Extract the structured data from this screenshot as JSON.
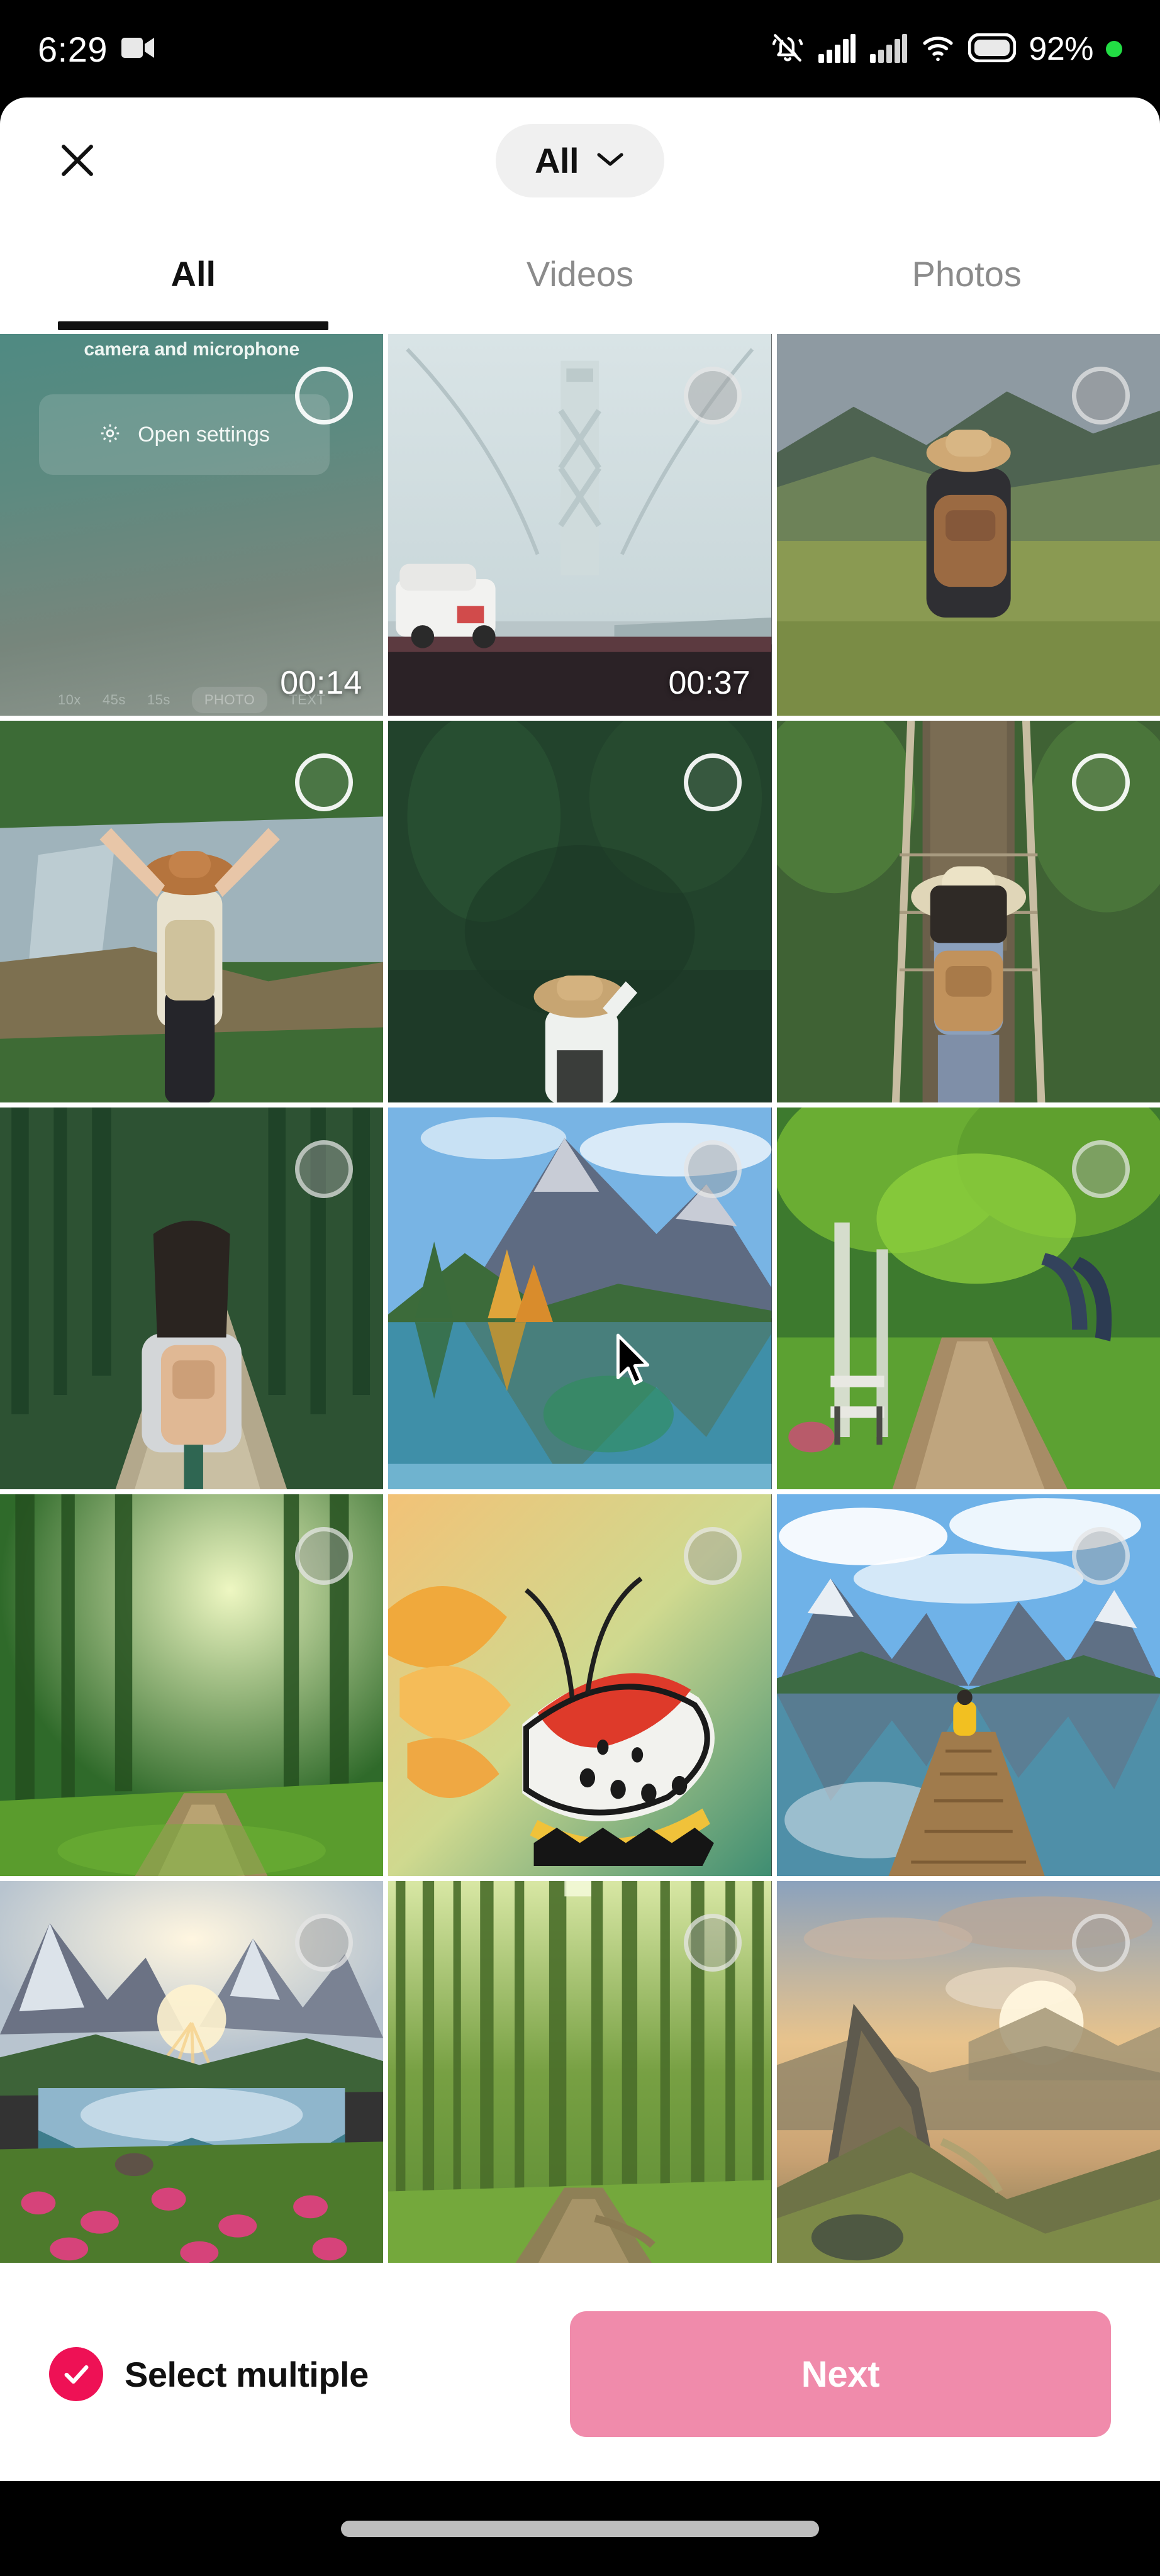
{
  "status_bar": {
    "time": "6:29",
    "battery_percent": "92%",
    "icons": [
      "video-camera-icon",
      "notifications-silenced-icon",
      "cellular-signal-1-icon",
      "cellular-signal-2-icon",
      "wifi-icon",
      "battery-icon",
      "privacy-indicator-dot"
    ],
    "privacy_dot_color": "#22dd44"
  },
  "header": {
    "close_label": "Close",
    "filter_label": "All",
    "filter_chevron": "chevron-down-icon",
    "pill_bg": "#f0f0f0"
  },
  "tabs": [
    {
      "label": "All",
      "active": true
    },
    {
      "label": "Videos",
      "active": false
    },
    {
      "label": "Photos",
      "active": false
    }
  ],
  "gallery": {
    "items": [
      {
        "id": "tile-1",
        "kind": "video",
        "duration": "00:14",
        "description": "screen recording showing camera and microphone permission prompt",
        "overlay": {
          "title": "camera and microphone",
          "button": "Open settings",
          "button_icon": "gear-icon",
          "modes": [
            "10x",
            "45s",
            "15s",
            "PHOTO",
            "TEXT"
          ],
          "active_mode": "PHOTO"
        },
        "selected": false,
        "checkbox_dim": false
      },
      {
        "id": "tile-2",
        "kind": "video",
        "duration": "00:37",
        "description": "dashcam view of suspension bridge with white SUV",
        "selected": false,
        "checkbox_dim": true
      },
      {
        "id": "tile-3",
        "kind": "photo",
        "duration": "",
        "description": "hiker with backpack and beanie in green mountain meadow",
        "selected": false,
        "checkbox_dim": true
      },
      {
        "id": "tile-4",
        "kind": "photo",
        "duration": "",
        "description": "woman with arms raised by waterfall",
        "selected": false,
        "checkbox_dim": false
      },
      {
        "id": "tile-5",
        "kind": "photo",
        "duration": "",
        "description": "person holding hat in dark forest",
        "selected": false,
        "checkbox_dim": false
      },
      {
        "id": "tile-6",
        "kind": "photo",
        "duration": "",
        "description": "hiker with hat and backpack on rope suspension bridge",
        "selected": false,
        "checkbox_dim": false
      },
      {
        "id": "tile-7",
        "kind": "photo",
        "duration": "",
        "description": "woman with backpack walking forest trail",
        "selected": false,
        "checkbox_dim": true
      },
      {
        "id": "tile-8",
        "kind": "photo",
        "duration": "",
        "description": "autumn mountain lake reflection",
        "selected": false,
        "checkbox_dim": true
      },
      {
        "id": "tile-9",
        "kind": "photo",
        "duration": "",
        "description": "sunlit green tree lined path with bench",
        "selected": false,
        "checkbox_dim": true
      },
      {
        "id": "tile-10",
        "kind": "photo",
        "duration": "",
        "description": "sunbeams through tall forest path",
        "selected": false,
        "checkbox_dim": true
      },
      {
        "id": "tile-11",
        "kind": "photo",
        "duration": "",
        "description": "orange and black butterfly on flower",
        "selected": false,
        "checkbox_dim": true
      },
      {
        "id": "tile-12",
        "kind": "photo",
        "duration": "",
        "description": "wooden pier over mountain lake with person in yellow jacket",
        "selected": false,
        "checkbox_dim": true
      },
      {
        "id": "tile-13",
        "kind": "photo",
        "duration": "",
        "description": "sunrise over alpine lake with pink wildflowers",
        "selected": false,
        "checkbox_dim": true
      },
      {
        "id": "tile-14",
        "kind": "photo",
        "duration": "",
        "description": "tall slender trees in green forest",
        "selected": false,
        "checkbox_dim": true
      },
      {
        "id": "tile-15",
        "kind": "photo",
        "duration": "",
        "description": "golden sunset over mountain cliffs",
        "selected": false,
        "checkbox_dim": true
      }
    ]
  },
  "bottom_bar": {
    "select_multiple_label": "Select multiple",
    "select_multiple_checked": true,
    "next_label": "Next",
    "accent_color": "#ee1155",
    "next_button_color": "#f08bab"
  },
  "nav_bar": {
    "home_indicator": "home-indicator"
  }
}
